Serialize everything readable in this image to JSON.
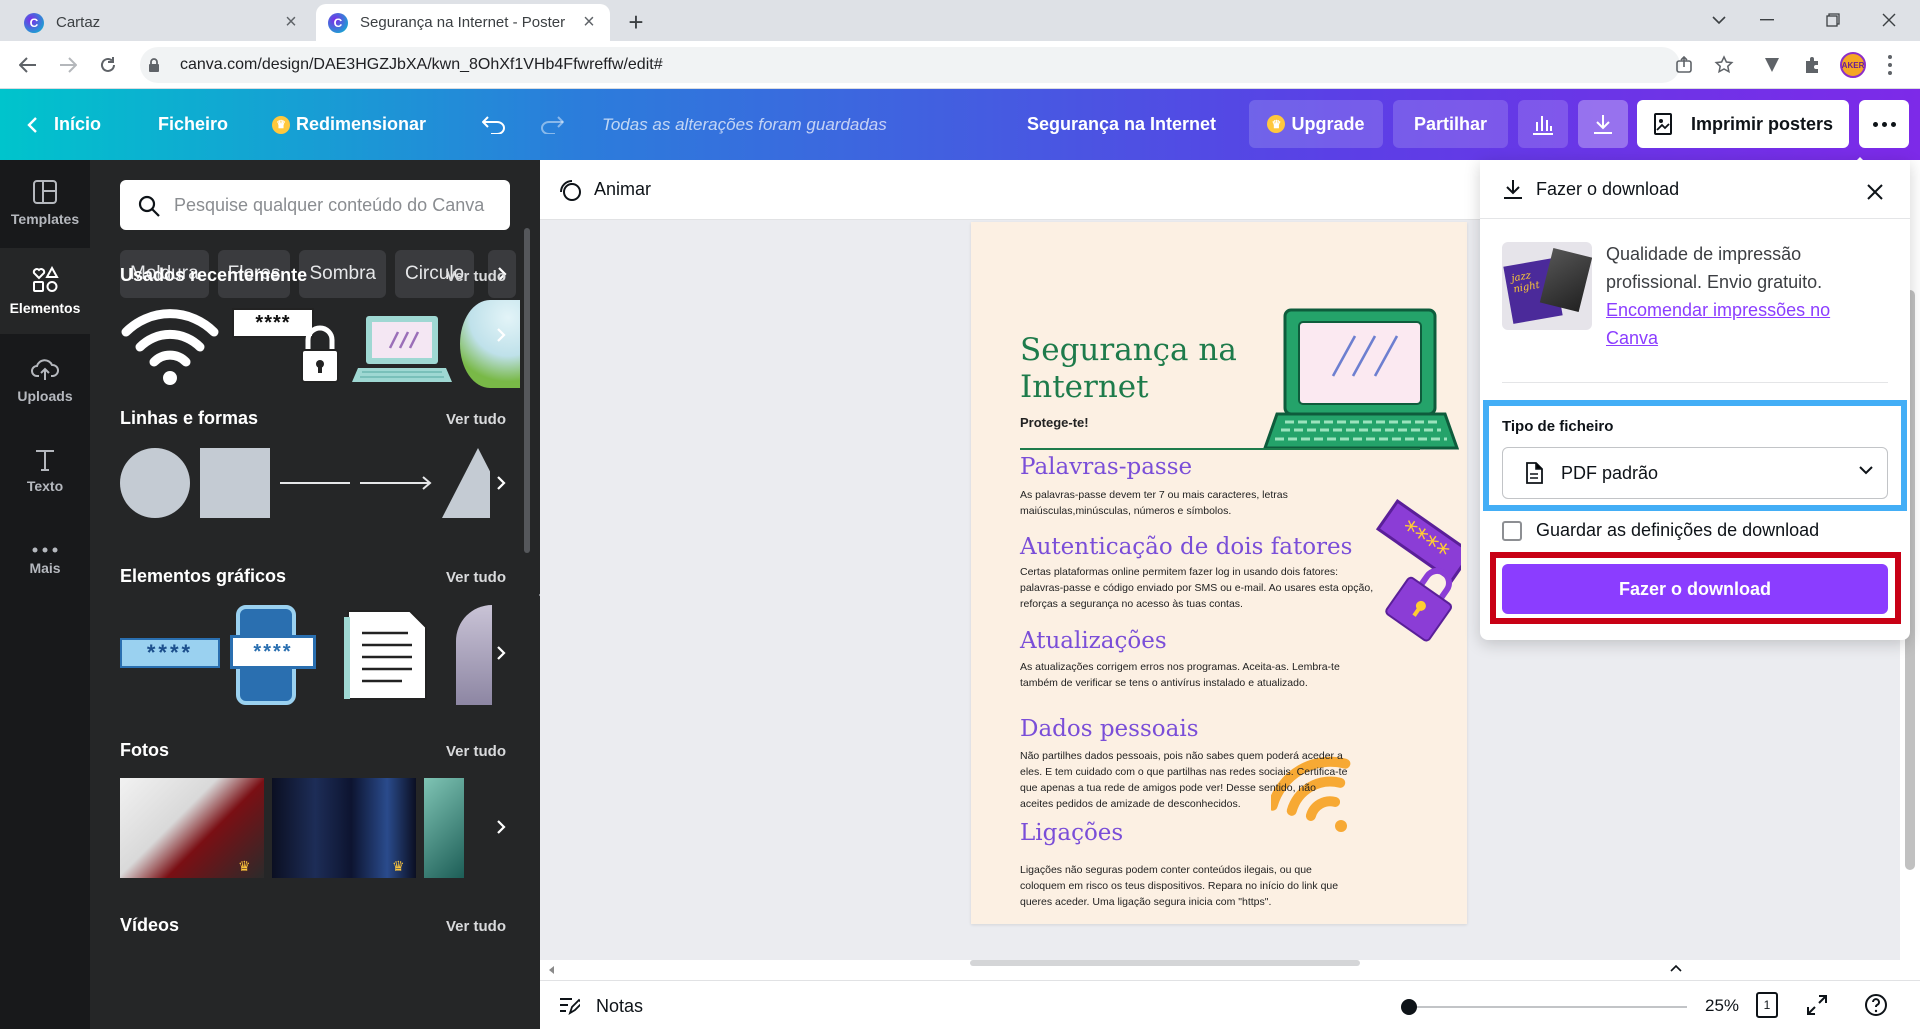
{
  "browser": {
    "tabs": [
      {
        "title": "Cartaz",
        "active": false
      },
      {
        "title": "Segurança na Internet - Poster",
        "active": true
      }
    ],
    "url": "canva.com/design/DAE3HGZJbXA/kwn_8OhXf1VHb4Ffwreffw/edit#",
    "profile_initials": "AKER"
  },
  "topbar": {
    "home": "Início",
    "file": "Ficheiro",
    "resize": "Redimensionar",
    "saved_status": "Todas as alterações foram guardadas",
    "doc_title": "Segurança na Internet",
    "upgrade": "Upgrade",
    "share": "Partilhar",
    "print": "Imprimir posters",
    "brand_gradient": [
      "#00c4cc",
      "#7d2ae8"
    ]
  },
  "rail": [
    {
      "label": "Templates",
      "icon": "templates-icon"
    },
    {
      "label": "Elementos",
      "icon": "elements-icon"
    },
    {
      "label": "Uploads",
      "icon": "upload-icon"
    },
    {
      "label": "Texto",
      "icon": "text-icon"
    },
    {
      "label": "Mais",
      "icon": "more-dots-icon"
    }
  ],
  "panel": {
    "search_placeholder": "Pesquise qualquer conteúdo do Canva",
    "chips": [
      "Moldura",
      "Flores",
      "Sombra",
      "Circulo"
    ],
    "see_all": "Ver tudo",
    "sections": {
      "recent": "Usados recentemente",
      "lines": "Linhas e formas",
      "graphics": "Elementos gráficos",
      "photos": "Fotos",
      "videos": "Vídeos"
    },
    "password_mask": "****"
  },
  "canvas": {
    "animate": "Animar",
    "notes": "Notas",
    "zoom": "25%",
    "page_number": "1",
    "zoom_fraction": 0.0
  },
  "poster": {
    "title": "Segurança na Internet",
    "subtitle": "Protege-te!",
    "sections": [
      {
        "heading": "Palavras-passe",
        "body": "As palavras-passe devem ter 7 ou mais caracteres, letras maiúsculas,minúsculas, números e símbolos."
      },
      {
        "heading": "Autenticação de dois fatores",
        "body": "Certas plataformas online permitem fazer log in usando dois fatores: palavras-passe e código enviado por SMS ou e-mail. Ao usares esta opção, reforças a segurança no acesso às tuas contas."
      },
      {
        "heading": "Atualizações",
        "body": "As atualizações corrigem erros nos programas. Aceita-as. Lembra-te também de verificar se tens o antivírus instalado e atualizado."
      },
      {
        "heading": "Dados pessoais",
        "body": "Não partilhes dados pessoais, pois não sabes quem poderá aceder a eles. E tem cuidado com o que partilhas nas redes sociais. Certifica-te que apenas a tua rede de amigos pode ver! Desse sentido, não aceites pedidos de amizade de desconhecidos."
      },
      {
        "heading": "Ligações",
        "body": "Ligações não seguras podem conter conteúdos ilegais, ou que coloquem em risco os teus dispositivos. Repara no início do link que queres aceder. Uma ligação segura inicia com \"https\"."
      }
    ],
    "colors": {
      "title": "#1e7b4b",
      "heading": "#7a4ed8",
      "background": "#fcf0e3"
    }
  },
  "download": {
    "header": "Fazer o download",
    "print_text": "Qualidade de impressão profissional. Envio gratuito.",
    "print_link": "Encomendar impressões no Canva",
    "thumb_text": "jazz night",
    "file_type_label": "Tipo de ficheiro",
    "file_type_value": "PDF padrão",
    "save_settings": "Guardar as definições de download",
    "save_settings_checked": false,
    "button": "Fazer o download",
    "button_color": "#8b3dff",
    "highlight_colors": [
      "#43aef6",
      "#c80015"
    ]
  }
}
